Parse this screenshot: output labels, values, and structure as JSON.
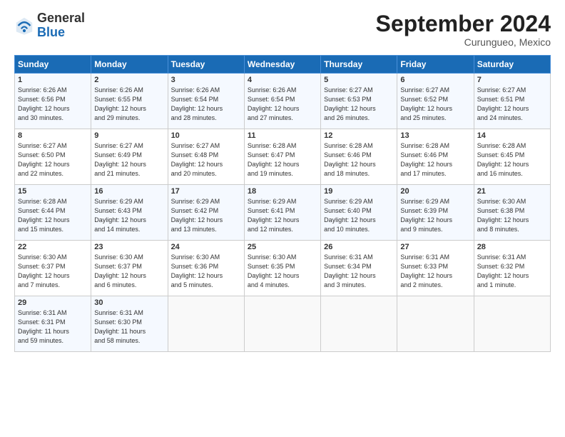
{
  "header": {
    "logo_line1": "General",
    "logo_line2": "Blue",
    "month_title": "September 2024",
    "location": "Curungueo, Mexico"
  },
  "weekdays": [
    "Sunday",
    "Monday",
    "Tuesday",
    "Wednesday",
    "Thursday",
    "Friday",
    "Saturday"
  ],
  "weeks": [
    [
      {
        "day": "1",
        "info": "Sunrise: 6:26 AM\nSunset: 6:56 PM\nDaylight: 12 hours\nand 30 minutes."
      },
      {
        "day": "2",
        "info": "Sunrise: 6:26 AM\nSunset: 6:55 PM\nDaylight: 12 hours\nand 29 minutes."
      },
      {
        "day": "3",
        "info": "Sunrise: 6:26 AM\nSunset: 6:54 PM\nDaylight: 12 hours\nand 28 minutes."
      },
      {
        "day": "4",
        "info": "Sunrise: 6:26 AM\nSunset: 6:54 PM\nDaylight: 12 hours\nand 27 minutes."
      },
      {
        "day": "5",
        "info": "Sunrise: 6:27 AM\nSunset: 6:53 PM\nDaylight: 12 hours\nand 26 minutes."
      },
      {
        "day": "6",
        "info": "Sunrise: 6:27 AM\nSunset: 6:52 PM\nDaylight: 12 hours\nand 25 minutes."
      },
      {
        "day": "7",
        "info": "Sunrise: 6:27 AM\nSunset: 6:51 PM\nDaylight: 12 hours\nand 24 minutes."
      }
    ],
    [
      {
        "day": "8",
        "info": "Sunrise: 6:27 AM\nSunset: 6:50 PM\nDaylight: 12 hours\nand 22 minutes."
      },
      {
        "day": "9",
        "info": "Sunrise: 6:27 AM\nSunset: 6:49 PM\nDaylight: 12 hours\nand 21 minutes."
      },
      {
        "day": "10",
        "info": "Sunrise: 6:27 AM\nSunset: 6:48 PM\nDaylight: 12 hours\nand 20 minutes."
      },
      {
        "day": "11",
        "info": "Sunrise: 6:28 AM\nSunset: 6:47 PM\nDaylight: 12 hours\nand 19 minutes."
      },
      {
        "day": "12",
        "info": "Sunrise: 6:28 AM\nSunset: 6:46 PM\nDaylight: 12 hours\nand 18 minutes."
      },
      {
        "day": "13",
        "info": "Sunrise: 6:28 AM\nSunset: 6:46 PM\nDaylight: 12 hours\nand 17 minutes."
      },
      {
        "day": "14",
        "info": "Sunrise: 6:28 AM\nSunset: 6:45 PM\nDaylight: 12 hours\nand 16 minutes."
      }
    ],
    [
      {
        "day": "15",
        "info": "Sunrise: 6:28 AM\nSunset: 6:44 PM\nDaylight: 12 hours\nand 15 minutes."
      },
      {
        "day": "16",
        "info": "Sunrise: 6:29 AM\nSunset: 6:43 PM\nDaylight: 12 hours\nand 14 minutes."
      },
      {
        "day": "17",
        "info": "Sunrise: 6:29 AM\nSunset: 6:42 PM\nDaylight: 12 hours\nand 13 minutes."
      },
      {
        "day": "18",
        "info": "Sunrise: 6:29 AM\nSunset: 6:41 PM\nDaylight: 12 hours\nand 12 minutes."
      },
      {
        "day": "19",
        "info": "Sunrise: 6:29 AM\nSunset: 6:40 PM\nDaylight: 12 hours\nand 10 minutes."
      },
      {
        "day": "20",
        "info": "Sunrise: 6:29 AM\nSunset: 6:39 PM\nDaylight: 12 hours\nand 9 minutes."
      },
      {
        "day": "21",
        "info": "Sunrise: 6:30 AM\nSunset: 6:38 PM\nDaylight: 12 hours\nand 8 minutes."
      }
    ],
    [
      {
        "day": "22",
        "info": "Sunrise: 6:30 AM\nSunset: 6:37 PM\nDaylight: 12 hours\nand 7 minutes."
      },
      {
        "day": "23",
        "info": "Sunrise: 6:30 AM\nSunset: 6:37 PM\nDaylight: 12 hours\nand 6 minutes."
      },
      {
        "day": "24",
        "info": "Sunrise: 6:30 AM\nSunset: 6:36 PM\nDaylight: 12 hours\nand 5 minutes."
      },
      {
        "day": "25",
        "info": "Sunrise: 6:30 AM\nSunset: 6:35 PM\nDaylight: 12 hours\nand 4 minutes."
      },
      {
        "day": "26",
        "info": "Sunrise: 6:31 AM\nSunset: 6:34 PM\nDaylight: 12 hours\nand 3 minutes."
      },
      {
        "day": "27",
        "info": "Sunrise: 6:31 AM\nSunset: 6:33 PM\nDaylight: 12 hours\nand 2 minutes."
      },
      {
        "day": "28",
        "info": "Sunrise: 6:31 AM\nSunset: 6:32 PM\nDaylight: 12 hours\nand 1 minute."
      }
    ],
    [
      {
        "day": "29",
        "info": "Sunrise: 6:31 AM\nSunset: 6:31 PM\nDaylight: 11 hours\nand 59 minutes."
      },
      {
        "day": "30",
        "info": "Sunrise: 6:31 AM\nSunset: 6:30 PM\nDaylight: 11 hours\nand 58 minutes."
      },
      {
        "day": "",
        "info": ""
      },
      {
        "day": "",
        "info": ""
      },
      {
        "day": "",
        "info": ""
      },
      {
        "day": "",
        "info": ""
      },
      {
        "day": "",
        "info": ""
      }
    ]
  ]
}
